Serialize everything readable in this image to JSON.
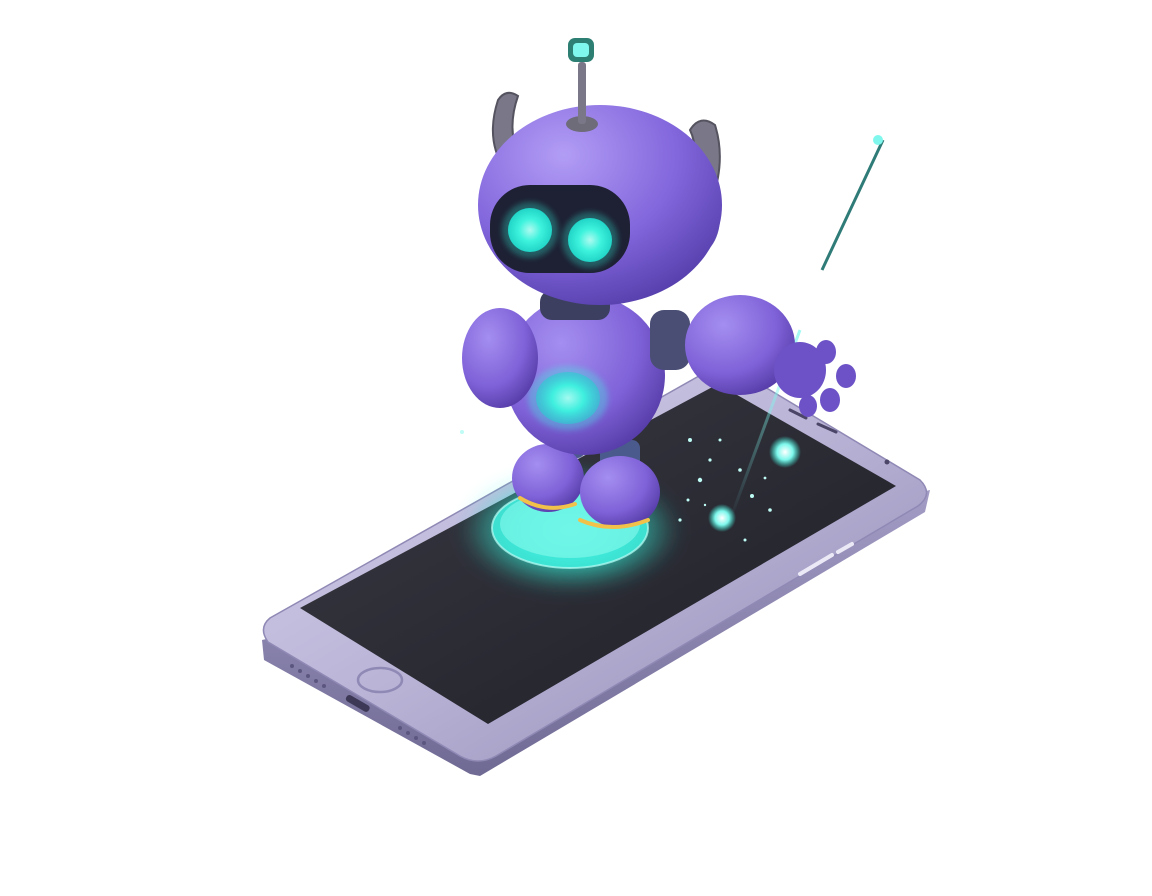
{
  "scene": {
    "subject": "robot-on-smartphone",
    "colors": {
      "background": "#ffffff",
      "robot_purple": "#7f62d8",
      "robot_purple_dark": "#5a3fb0",
      "robot_purple_light": "#a48ef0",
      "glow_cyan": "#32f0d8",
      "phone_frame": "#b9b3d6",
      "phone_screen": "#2a2a33",
      "antenna_metal": "#8a8790"
    }
  }
}
